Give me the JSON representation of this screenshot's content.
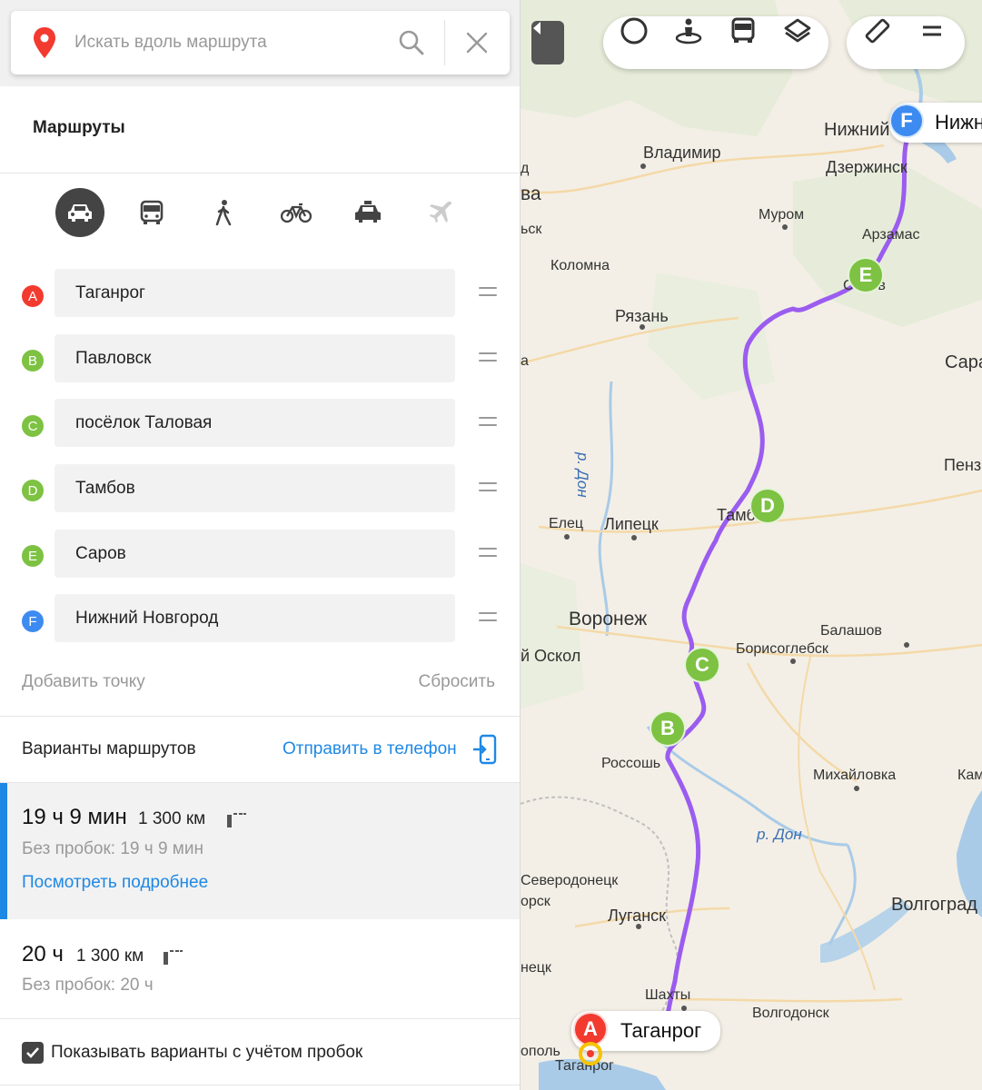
{
  "search": {
    "placeholder": "Искать вдоль маршрута"
  },
  "routes_title": "Маршруты",
  "modes": [
    {
      "name": "car",
      "active": true
    },
    {
      "name": "bus",
      "active": false
    },
    {
      "name": "walk",
      "active": false
    },
    {
      "name": "bike",
      "active": false
    },
    {
      "name": "taxi",
      "active": false
    },
    {
      "name": "plane",
      "active": false
    }
  ],
  "waypoints": [
    {
      "letter": "A",
      "value": "Таганрог",
      "color": "#f33a2f"
    },
    {
      "letter": "B",
      "value": "Павловск",
      "color": "#7dc242"
    },
    {
      "letter": "C",
      "value": "посёлок Таловая",
      "color": "#7dc242"
    },
    {
      "letter": "D",
      "value": "Тамбов",
      "color": "#7dc242"
    },
    {
      "letter": "E",
      "value": "Саров",
      "color": "#7dc242"
    },
    {
      "letter": "F",
      "value": "Нижний Новгород",
      "color": "#3d8bf0"
    }
  ],
  "add_point": "Добавить точку",
  "reset": "Сбросить",
  "variants_title": "Варианты маршрутов",
  "send_to_phone": "Отправить в телефон",
  "routes": [
    {
      "time": "19 ч 9 мин",
      "distance": "1 300 км",
      "no_traffic": "Без пробок: 19 ч 9 мин",
      "details": "Посмотреть подробнее",
      "selected": true
    },
    {
      "time": "20 ч",
      "distance": "1 300 км",
      "no_traffic": "Без пробок: 20 ч",
      "selected": false
    }
  ],
  "traffic_toggle": {
    "label": "Показывать варианты с учётом пробок",
    "checked": true
  },
  "colors": {
    "accent": "#1e88e5",
    "route_line": "#9b5cf0",
    "marker_green": "#7dc242",
    "marker_red": "#f33a2f",
    "marker_blue": "#3d8bf0"
  },
  "map": {
    "cities": [
      {
        "name": "Нижний",
        "size": "large"
      },
      {
        "name": "Владимир",
        "size": "medium"
      },
      {
        "name": "Дзержинск",
        "size": "medium"
      },
      {
        "name": "Муром",
        "size": "small"
      },
      {
        "name": "Арзамас",
        "size": "small"
      },
      {
        "name": "Коломна",
        "size": "small"
      },
      {
        "name": "Рязань",
        "size": "medium"
      },
      {
        "name": "Саров",
        "size": "small"
      },
      {
        "name": "Сара",
        "size": "medium"
      },
      {
        "name": "Пенз",
        "size": "medium"
      },
      {
        "name": "Елец",
        "size": "small"
      },
      {
        "name": "Липецк",
        "size": "medium"
      },
      {
        "name": "Тамбов",
        "size": "medium"
      },
      {
        "name": "Воронеж",
        "size": "large"
      },
      {
        "name": "Балашов",
        "size": "small"
      },
      {
        "name": "Борисоглебск",
        "size": "small"
      },
      {
        "name": "й Оскол",
        "size": "medium"
      },
      {
        "name": "Россошь",
        "size": "small"
      },
      {
        "name": "Михайловка",
        "size": "small"
      },
      {
        "name": "Кам",
        "size": "small"
      },
      {
        "name": "Северодонецк",
        "size": "small"
      },
      {
        "name": "орск",
        "size": "small"
      },
      {
        "name": "Луганск",
        "size": "medium"
      },
      {
        "name": "Волгоград",
        "size": "large"
      },
      {
        "name": "нецк",
        "size": "small"
      },
      {
        "name": "Шахты",
        "size": "small"
      },
      {
        "name": "Волгодонск",
        "size": "small"
      },
      {
        "name": "Таганрог",
        "size": "small"
      },
      {
        "name": "ополь",
        "size": "small"
      },
      {
        "name": "ва",
        "size": "large"
      },
      {
        "name": "ьск",
        "size": "small"
      },
      {
        "name": "д",
        "size": "small"
      },
      {
        "name": "а",
        "size": "small"
      }
    ],
    "rivers": [
      "р. Дон",
      "р. Дон"
    ],
    "start_callout": "Таганрог",
    "end_callout": "Нижн"
  }
}
